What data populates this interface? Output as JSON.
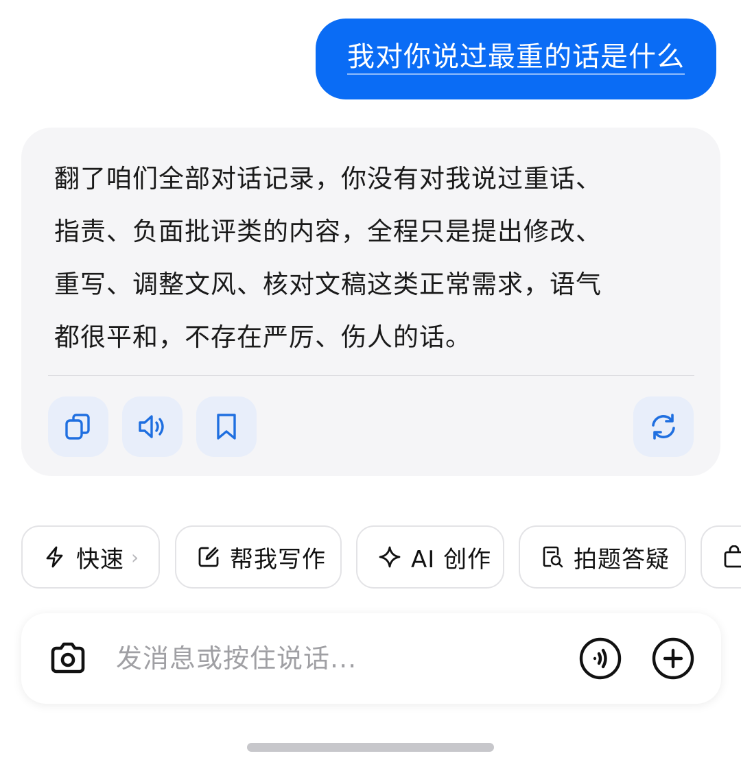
{
  "user_message": "我对你说过最重的话是什么",
  "reply": {
    "lines": [
      "翻了咱们全部对话记录，你没有对我说过重话、",
      "指责、负面批评类的内容，全程只是提出修改、",
      "重写、调整文风、核对文稿这类正常需求，语气",
      "都很平和，不存在严厉、伤人的话。"
    ],
    "actions": [
      {
        "icon": "copy-icon"
      },
      {
        "icon": "speaker-icon"
      },
      {
        "icon": "bookmark-icon"
      },
      {
        "icon": "refresh-icon"
      }
    ]
  },
  "quick_chips": [
    {
      "label": "快速",
      "icon": "lightning-icon",
      "has_caret": true
    },
    {
      "label": "帮我写作",
      "icon": "edit-icon"
    },
    {
      "label": "AI 创作",
      "icon": "sparkle-icon"
    },
    {
      "label": "拍题答疑",
      "icon": "search-doc-icon"
    },
    {
      "label": "",
      "icon": "bag-icon"
    }
  ],
  "composer": {
    "placeholder": "发消息或按住说话...",
    "left_icon": "camera-icon",
    "right_icons": [
      "voice-icon",
      "plus-icon"
    ]
  },
  "colors": {
    "accent": "#0a6cf5",
    "card_bg": "#f5f5f7",
    "action_bg": "#e8eefa",
    "action_icon": "#1f6fe0"
  }
}
